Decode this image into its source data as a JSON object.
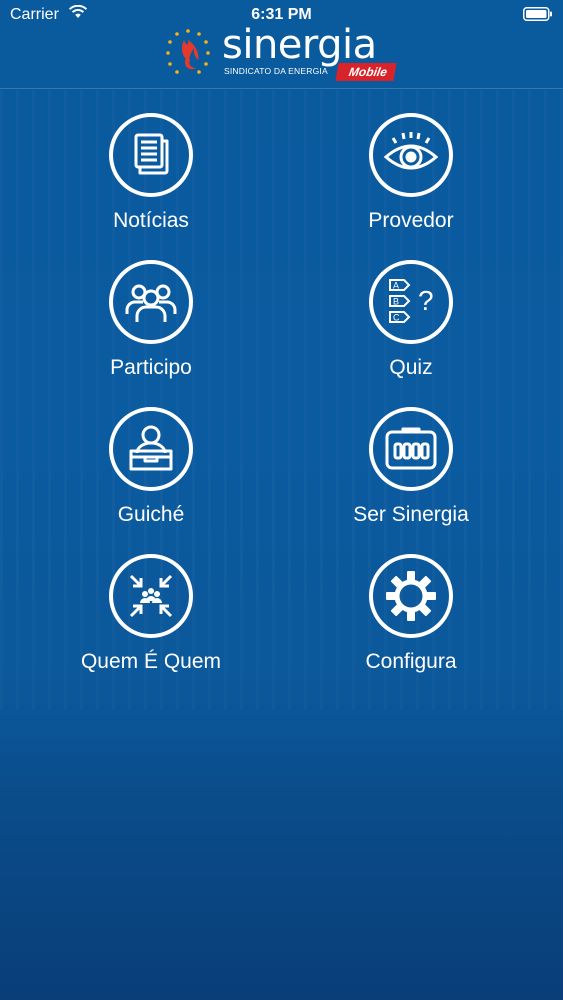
{
  "status_bar": {
    "carrier": "Carrier",
    "time": "6:31 PM",
    "icons": [
      "wifi-icon",
      "battery-icon"
    ]
  },
  "header": {
    "logo_word": "sinergia",
    "logo_subtitle": "SINDICATO DA ENERGIA",
    "logo_badge": "Mobile"
  },
  "colors": {
    "background": "#0b5ba0",
    "badge": "#d8232a",
    "flame": "#e53a2b",
    "stars": "#f3b41b"
  },
  "menu": [
    {
      "label": "Notícias",
      "icon": "news-icon"
    },
    {
      "label": "Provedor",
      "icon": "eye-icon"
    },
    {
      "label": "Participo",
      "icon": "group-icon"
    },
    {
      "label": "Quiz",
      "icon": "quiz-icon"
    },
    {
      "label": "Guiché",
      "icon": "counter-icon"
    },
    {
      "label": "Ser Sinergia",
      "icon": "card-icon"
    },
    {
      "label": "Quem É Quem",
      "icon": "meeting-icon"
    },
    {
      "label": "Configura",
      "icon": "gear-icon"
    }
  ]
}
